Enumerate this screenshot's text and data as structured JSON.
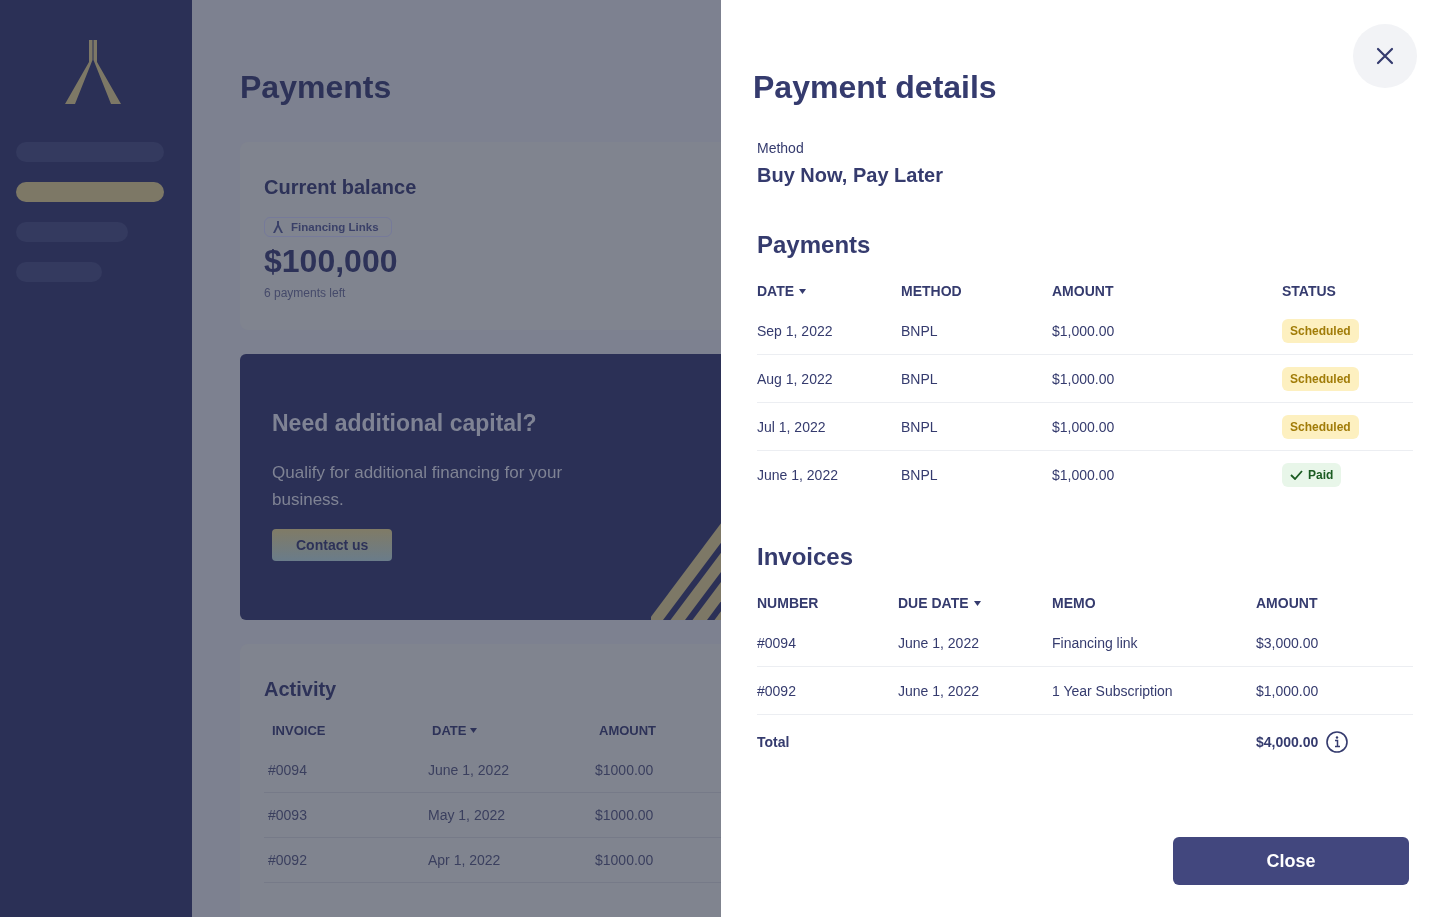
{
  "sidebar": {
    "items": [
      {
        "selected": false
      },
      {
        "selected": true
      },
      {
        "selected": false
      },
      {
        "selected": false
      }
    ]
  },
  "page": {
    "title": "Payments",
    "balance_card": {
      "title": "Current balance",
      "tag": "Financing Links",
      "amount": "$100,000",
      "note": "6 payments left"
    },
    "promo_card": {
      "title": "Need additional capital?",
      "text": "Qualify for additional financing for your business.",
      "button": "Contact us"
    },
    "activity": {
      "title": "Activity",
      "columns": [
        {
          "label": "INVOICE",
          "sorted": false
        },
        {
          "label": "DATE",
          "sorted": true
        },
        {
          "label": "AMOUNT",
          "sorted": false
        }
      ],
      "rows": [
        [
          "#0094",
          "June 1, 2022",
          "$1000.00"
        ],
        [
          "#0093",
          "May 1, 2022",
          "$1000.00"
        ],
        [
          "#0092",
          "Apr 1, 2022",
          "$1000.00"
        ]
      ]
    }
  },
  "drawer": {
    "title": "Payment details",
    "method_label": "Method",
    "method_value": "Buy Now, Pay Later",
    "payments": {
      "title": "Payments",
      "columns": [
        {
          "label": "DATE",
          "sorted": true
        },
        {
          "label": "METHOD",
          "sorted": false
        },
        {
          "label": "AMOUNT",
          "sorted": false
        },
        {
          "label": "STATUS",
          "sorted": false
        }
      ],
      "rows": [
        {
          "date": "Sep 1, 2022",
          "method": "BNPL",
          "amount": "$1,000.00",
          "status": {
            "kind": "scheduled",
            "label": "Scheduled"
          }
        },
        {
          "date": "Aug 1, 2022",
          "method": "BNPL",
          "amount": "$1,000.00",
          "status": {
            "kind": "scheduled",
            "label": "Scheduled"
          }
        },
        {
          "date": "Jul 1, 2022",
          "method": "BNPL",
          "amount": "$1,000.00",
          "status": {
            "kind": "scheduled",
            "label": "Scheduled"
          }
        },
        {
          "date": "June 1, 2022",
          "method": "BNPL",
          "amount": "$1,000.00",
          "status": {
            "kind": "paid",
            "label": "Paid"
          }
        }
      ]
    },
    "invoices": {
      "title": "Invoices",
      "columns": [
        {
          "label": "NUMBER",
          "sorted": false
        },
        {
          "label": "DUE DATE",
          "sorted": true
        },
        {
          "label": "MEMO",
          "sorted": false
        },
        {
          "label": "AMOUNT",
          "sorted": false
        }
      ],
      "rows": [
        [
          "#0094",
          "June 1, 2022",
          "Financing link",
          "$3,000.00"
        ],
        [
          "#0092",
          "June 1, 2022",
          "1 Year Subscription",
          "$1,000.00"
        ]
      ],
      "total_label": "Total",
      "total_value": "$4,000.00"
    },
    "close_button": "Close"
  }
}
